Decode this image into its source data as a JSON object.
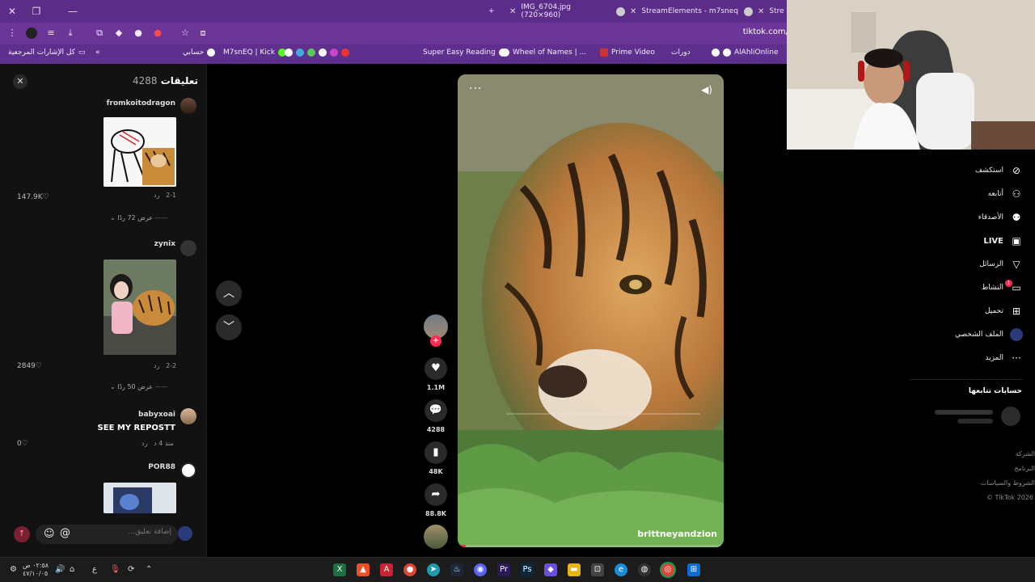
{
  "browser": {
    "tabs": [
      {
        "title": "IMG_6704.jpg (720×960)"
      },
      {
        "title": "StreamElements - m7sneq"
      },
      {
        "title": "Stre"
      }
    ],
    "url": "tiktok.com/",
    "bookmarks": [
      {
        "label": "كل الإشارات المرجعية"
      },
      {
        "label": "حسابي"
      },
      {
        "label": "M7snEQ | Kick"
      },
      {
        "label": "Super Easy Reading"
      },
      {
        "label": "Wheel of Names | ..."
      },
      {
        "label": "دورات"
      },
      {
        "label": "Prime Video"
      },
      {
        "label": "AlAhliOnline"
      }
    ]
  },
  "comments": {
    "title": "تعليقات",
    "count": "4288",
    "close_icon": "close-icon",
    "items": [
      {
        "user": "fromkoitodragon",
        "date": "2-1",
        "reply": "رد",
        "likes": "147.9K",
        "view_replies": "عرض 72 ردًا"
      },
      {
        "user": "zynix",
        "date": "2-2",
        "reply": "رد",
        "likes": "2849",
        "view_replies": "عرض 50 ردًا"
      },
      {
        "user": "babyxoai",
        "text": "SEE MY REPOSTT",
        "date": "منذ 4 د",
        "reply": "رد",
        "likes": "0"
      },
      {
        "user": "POR88"
      }
    ],
    "input_placeholder": "إضافة تعليق..."
  },
  "video": {
    "username": "brittneyandzion",
    "progress": 0.03
  },
  "actions": {
    "likes": "1.1M",
    "comments": "4288",
    "saves": "48K",
    "shares": "88.8K"
  },
  "sidebar": {
    "items": [
      {
        "label": "استكشف",
        "icon": "compass-icon"
      },
      {
        "label": "أتابعه",
        "icon": "user-plus-icon"
      },
      {
        "label": "الأصدقاء",
        "icon": "friends-icon"
      },
      {
        "label": "LIVE",
        "icon": "live-icon"
      },
      {
        "label": "الرسائل",
        "icon": "send-icon"
      },
      {
        "label": "النشاط",
        "icon": "activity-icon",
        "badge": "1"
      },
      {
        "label": "تحميل",
        "icon": "upload-icon"
      },
      {
        "label": "الملف الشخصي",
        "icon": "profile-icon"
      },
      {
        "label": "المزيد",
        "icon": "more-icon"
      }
    ],
    "following_title": "حسابات تتابعها",
    "footer": [
      "الشركة",
      "البرنامج",
      "الشروط والسياسات",
      "TikTok 2026 ©"
    ]
  },
  "taskbar": {
    "time": "٠٢:٥٨ ص",
    "date": "٤٧/١٠/٠٥",
    "lang": "ع"
  },
  "colors": {
    "accent": "#fe2c55",
    "browser": "#5b2c88"
  }
}
